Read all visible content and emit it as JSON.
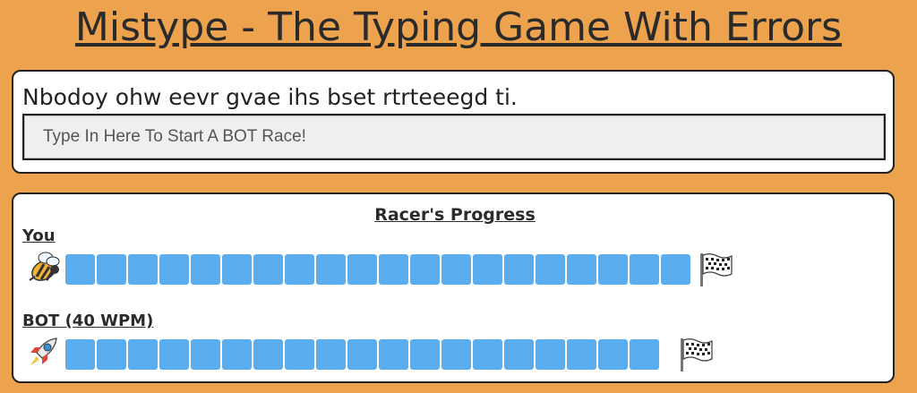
{
  "header": {
    "title": "Mistype - The Typing Game With Errors"
  },
  "typing": {
    "sentence": "Nbodoy ohw eevr gvae ihs bset rtrteeegd ti.",
    "input_placeholder": "Type In Here To Start A BOT Race!",
    "input_value": ""
  },
  "race": {
    "title": "Racer's Progress",
    "racers": [
      {
        "name": "You",
        "icon": "bee-icon",
        "progress_percent": 100
      },
      {
        "name": "BOT (40 WPM)",
        "icon": "rocket-icon",
        "progress_percent": 97
      }
    ]
  },
  "colors": {
    "background": "#eda34e",
    "progress_bar": "#5aaef0",
    "card": "#ffffff"
  }
}
